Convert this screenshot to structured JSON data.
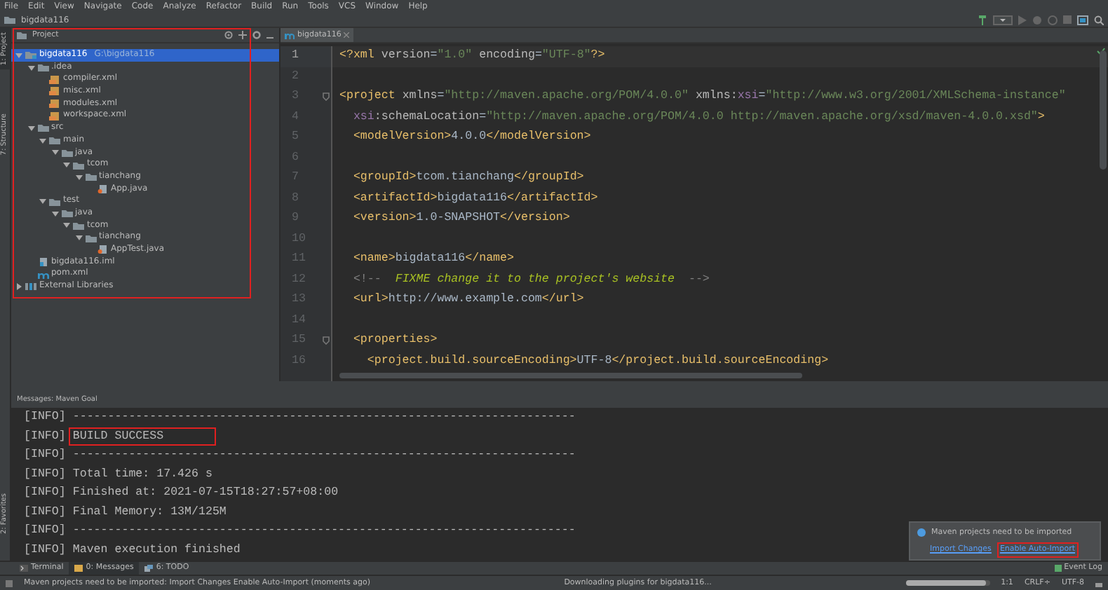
{
  "menu": [
    "File",
    "Edit",
    "View",
    "Navigate",
    "Code",
    "Analyze",
    "Refactor",
    "Build",
    "Run",
    "Tools",
    "VCS",
    "Window",
    "Help"
  ],
  "breadcrumb": "bigdata116",
  "left_tabs": [
    {
      "label": "1: Project",
      "selected": true
    },
    {
      "label": "7: Structure",
      "selected": false
    }
  ],
  "favorites_tab": "2: Favorites",
  "project_panel": {
    "title": "Project",
    "highlighted": true,
    "tree": [
      {
        "label": "bigdata116",
        "path": "G:\\bigdata116",
        "kind": "module",
        "selected": true,
        "expanded": true,
        "children": [
          {
            "label": ".idea",
            "kind": "folder",
            "selected": false,
            "expanded": true,
            "children": [
              {
                "label": "compiler.xml",
                "kind": "xml",
                "selected": false
              },
              {
                "label": "misc.xml",
                "kind": "xml",
                "selected": false
              },
              {
                "label": "modules.xml",
                "kind": "xml",
                "selected": false
              },
              {
                "label": "workspace.xml",
                "kind": "xml",
                "selected": false
              }
            ]
          },
          {
            "label": "src",
            "kind": "folder",
            "selected": false,
            "expanded": true,
            "children": [
              {
                "label": "main",
                "kind": "folder",
                "selected": false,
                "expanded": true,
                "children": [
                  {
                    "label": "java",
                    "kind": "folder",
                    "selected": false,
                    "expanded": true,
                    "children": [
                      {
                        "label": "tcom",
                        "kind": "folder",
                        "selected": false,
                        "expanded": true,
                        "children": [
                          {
                            "label": "tianchang",
                            "kind": "folder",
                            "selected": false,
                            "expanded": true,
                            "children": [
                              {
                                "label": "App.java",
                                "kind": "java",
                                "selected": false
                              }
                            ]
                          }
                        ]
                      }
                    ]
                  }
                ]
              },
              {
                "label": "test",
                "kind": "folder",
                "selected": false,
                "expanded": true,
                "children": [
                  {
                    "label": "java",
                    "kind": "folder",
                    "selected": false,
                    "expanded": true,
                    "children": [
                      {
                        "label": "tcom",
                        "kind": "folder",
                        "selected": false,
                        "expanded": true,
                        "children": [
                          {
                            "label": "tianchang",
                            "kind": "folder",
                            "selected": false,
                            "expanded": true,
                            "children": [
                              {
                                "label": "AppTest.java",
                                "kind": "java",
                                "selected": false
                              }
                            ]
                          }
                        ]
                      }
                    ]
                  }
                ]
              }
            ]
          },
          {
            "label": "bigdata116.iml",
            "kind": "iml",
            "selected": false
          },
          {
            "label": "pom.xml",
            "kind": "pom",
            "selected": false
          }
        ]
      },
      {
        "label": "External Libraries",
        "kind": "libraries",
        "selected": false,
        "expanded": false
      }
    ]
  },
  "editor": {
    "tabs": [
      {
        "label": "bigdata116",
        "selected": true
      }
    ],
    "lines": [
      {
        "number": "1",
        "current": true,
        "foldable": false,
        "tokens": [
          {
            "kind": "tag",
            "text": "<?xml "
          },
          {
            "kind": "attr",
            "text": "version"
          },
          {
            "kind": "text",
            "text": "="
          },
          {
            "kind": "string",
            "text": "\"1.0\""
          },
          {
            "kind": "attr",
            "text": " encoding"
          },
          {
            "kind": "text",
            "text": "="
          },
          {
            "kind": "string",
            "text": "\"UTF-8\""
          },
          {
            "kind": "tag",
            "text": "?>"
          }
        ]
      },
      {
        "number": "2",
        "current": false,
        "foldable": false
      },
      {
        "number": "3",
        "current": false,
        "foldable": true,
        "tokens": [
          {
            "kind": "tag",
            "text": "<project "
          },
          {
            "kind": "attr",
            "text": "xmlns"
          },
          {
            "kind": "text",
            "text": "="
          },
          {
            "kind": "string",
            "text": "\"http://maven.apache.org/POM/4.0.0\""
          },
          {
            "kind": "attr",
            "text": " xmlns:"
          },
          {
            "kind": "ns",
            "text": "xsi"
          },
          {
            "kind": "text",
            "text": "="
          },
          {
            "kind": "string",
            "text": "\"http://www.w3.org/2001/XMLSchema-instance\""
          }
        ]
      },
      {
        "number": "4",
        "current": false,
        "foldable": false,
        "tokens": [
          {
            "kind": "ns",
            "text": "  xsi"
          },
          {
            "kind": "attr",
            "text": ":schemaLocation"
          },
          {
            "kind": "text",
            "text": "="
          },
          {
            "kind": "string",
            "text": "\"http://maven.apache.org/POM/4.0.0 http://maven.apache.org/xsd/maven-4.0.0.xsd\""
          },
          {
            "kind": "tag",
            "text": ">"
          }
        ]
      },
      {
        "number": "5",
        "current": false,
        "foldable": false,
        "tokens": [
          {
            "kind": "tag",
            "text": "  <modelVersion>"
          },
          {
            "kind": "text",
            "text": "4.0.0"
          },
          {
            "kind": "tag",
            "text": "</modelVersion>"
          }
        ]
      },
      {
        "number": "6",
        "current": false,
        "foldable": false
      },
      {
        "number": "7",
        "current": false,
        "foldable": false,
        "tokens": [
          {
            "kind": "tag",
            "text": "  <groupId>"
          },
          {
            "kind": "text",
            "text": "tcom.tianchang"
          },
          {
            "kind": "tag",
            "text": "</groupId>"
          }
        ]
      },
      {
        "number": "8",
        "current": false,
        "foldable": false,
        "tokens": [
          {
            "kind": "tag",
            "text": "  <artifactId>"
          },
          {
            "kind": "text",
            "text": "bigdata116"
          },
          {
            "kind": "tag",
            "text": "</artifactId>"
          }
        ]
      },
      {
        "number": "9",
        "current": false,
        "foldable": false,
        "tokens": [
          {
            "kind": "tag",
            "text": "  <version>"
          },
          {
            "kind": "text",
            "text": "1.0-SNAPSHOT"
          },
          {
            "kind": "tag",
            "text": "</version>"
          }
        ]
      },
      {
        "number": "10",
        "current": false,
        "foldable": false
      },
      {
        "number": "11",
        "current": false,
        "foldable": false,
        "tokens": [
          {
            "kind": "tag",
            "text": "  <name>"
          },
          {
            "kind": "text",
            "text": "bigdata116"
          },
          {
            "kind": "tag",
            "text": "</name>"
          }
        ]
      },
      {
        "number": "12",
        "current": false,
        "foldable": false,
        "tokens": [
          {
            "kind": "comment",
            "text": "  <!--  "
          },
          {
            "kind": "todo",
            "text": "FIXME change it to the project's website"
          },
          {
            "kind": "comment",
            "text": "  -->"
          }
        ]
      },
      {
        "number": "13",
        "current": false,
        "foldable": false,
        "tokens": [
          {
            "kind": "tag",
            "text": "  <url>"
          },
          {
            "kind": "text",
            "text": "http://www.example.com"
          },
          {
            "kind": "tag",
            "text": "</url>"
          }
        ]
      },
      {
        "number": "14",
        "current": false,
        "foldable": false
      },
      {
        "number": "15",
        "current": false,
        "foldable": true,
        "tokens": [
          {
            "kind": "tag",
            "text": "  <properties>"
          }
        ]
      },
      {
        "number": "16",
        "current": false,
        "foldable": false,
        "tokens": [
          {
            "kind": "tag",
            "text": "    <project.build.sourceEncoding>"
          },
          {
            "kind": "text",
            "text": "UTF-8"
          },
          {
            "kind": "tag",
            "text": "</project.build.sourceEncoding>"
          }
        ]
      }
    ]
  },
  "messages_panel": {
    "title": "Messages: Maven Goal",
    "lines": [
      {
        "level": "[INFO]",
        "message": "------------------------------------------------------------------------",
        "highlighted": false
      },
      {
        "level": "[INFO]",
        "message": "BUILD SUCCESS",
        "highlighted": true
      },
      {
        "level": "[INFO]",
        "message": "------------------------------------------------------------------------",
        "highlighted": false
      },
      {
        "level": "[INFO]",
        "message": "Total time: 17.426 s",
        "highlighted": false
      },
      {
        "level": "[INFO]",
        "message": "Finished at: 2021-07-15T18:27:57+08:00",
        "highlighted": false
      },
      {
        "level": "[INFO]",
        "message": "Final Memory: 13M/125M",
        "highlighted": false
      },
      {
        "level": "[INFO]",
        "message": "------------------------------------------------------------------------",
        "highlighted": false
      },
      {
        "level": "[INFO]",
        "message": "Maven execution finished",
        "highlighted": false
      }
    ]
  },
  "bottom_tabs": [
    {
      "label": "Terminal",
      "selected": false
    },
    {
      "label": "0: Messages",
      "selected": true
    },
    {
      "label": "6: TODO",
      "selected": false
    }
  ],
  "event_log": "Event Log",
  "notification": {
    "title": "Maven projects need to be imported",
    "links": [
      {
        "label": "Import Changes",
        "highlighted": false
      },
      {
        "label": "Enable Auto-Import",
        "highlighted": true
      }
    ]
  },
  "status_bar": {
    "message": "Maven projects need to be imported: Import Changes  Enable Auto-Import (moments ago)",
    "task": "Downloading plugins for bigdata116...",
    "progress": {
      "level": 0.95
    },
    "position": "1:1",
    "line_separator": "CRLF÷",
    "encoding": "UTF-8"
  }
}
